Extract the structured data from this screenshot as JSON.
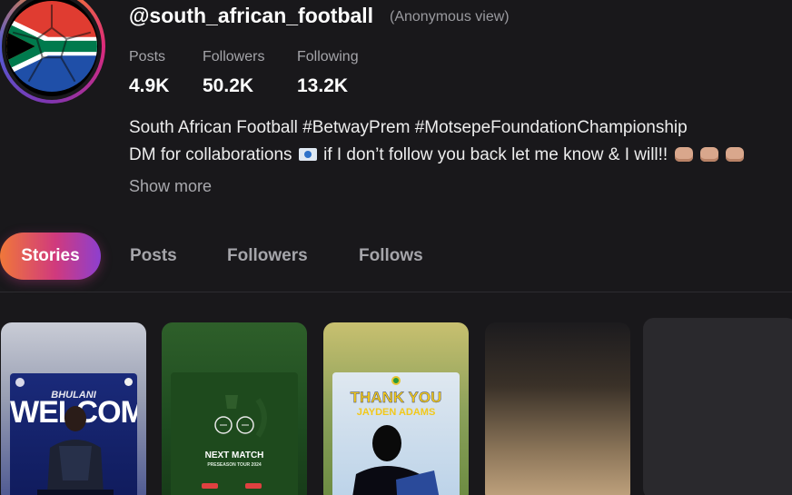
{
  "profile": {
    "username": "@south_african_football",
    "view_mode": "(Anonymous view)",
    "avatar_icon": "south-africa-flag-football-icon"
  },
  "stats": [
    {
      "label": "Posts",
      "value": "4.9K"
    },
    {
      "label": "Followers",
      "value": "50.2K"
    },
    {
      "label": "Following",
      "value": "13.2K"
    }
  ],
  "bio": {
    "line1": "South African Football #BetwayPrem #MotsepeFoundationChampionship",
    "line2_pre": "DM for collaborations",
    "line2_post": "if I don’t follow you back let me know & I will!!",
    "show_more": "Show more"
  },
  "tabs": [
    {
      "label": "Stories",
      "active": true
    },
    {
      "label": "Posts",
      "active": false
    },
    {
      "label": "Followers",
      "active": false
    },
    {
      "label": "Follows",
      "active": false
    }
  ],
  "stories": [
    {
      "title_top": "BHULANI",
      "title_main": "WELCOME"
    },
    {
      "title_main": "NEXT MATCH",
      "subtitle": "PRESEASON TOUR 2024"
    },
    {
      "title_main": "THANK YOU",
      "subtitle": "JAYDEN ADAMS"
    },
    {},
    {}
  ],
  "colors": {
    "background": "#19181b",
    "accent_gradient_start": "#f0773a",
    "accent_gradient_mid": "#d03a7d",
    "accent_gradient_end": "#8d3fcf"
  }
}
